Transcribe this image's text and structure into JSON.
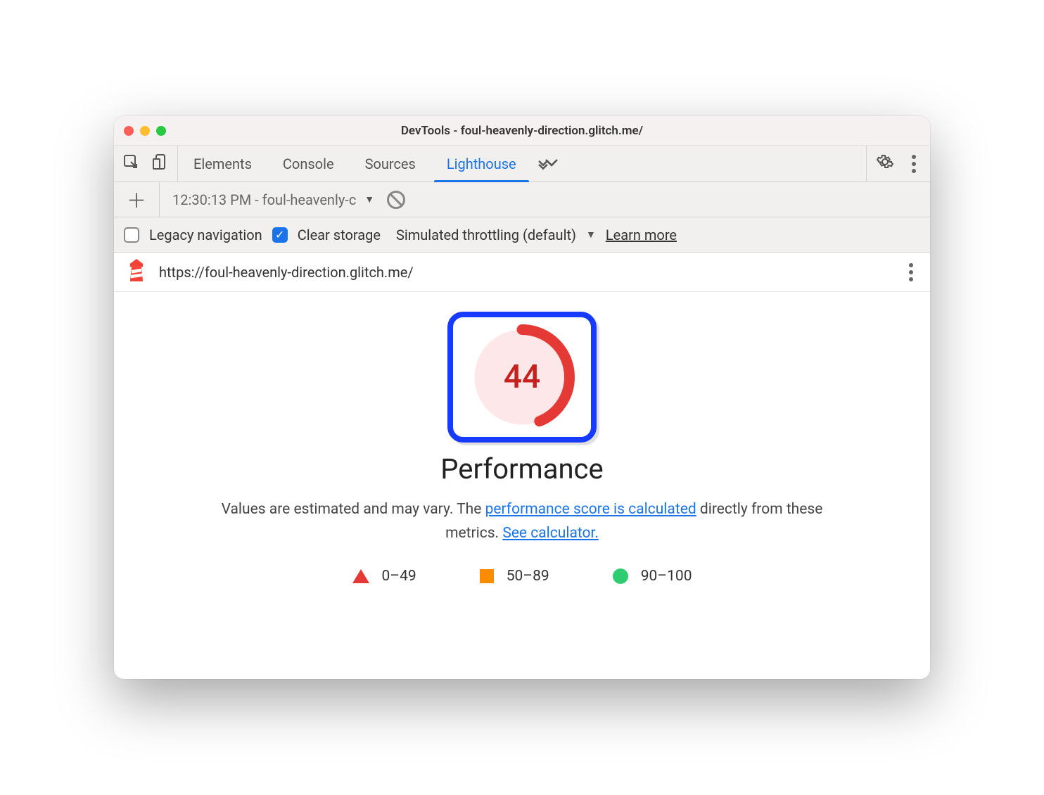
{
  "window": {
    "title": "DevTools - foul-heavenly-direction.glitch.me/"
  },
  "tabs": {
    "elements": "Elements",
    "console": "Console",
    "sources": "Sources",
    "lighthouse": "Lighthouse"
  },
  "secondary": {
    "report_label": "12:30:13 PM - foul-heavenly-c"
  },
  "options": {
    "legacy_label": "Legacy navigation",
    "clear_storage_label": "Clear storage",
    "throttling_label": "Simulated throttling (default)",
    "learn_more": "Learn more",
    "legacy_checked": false,
    "clear_storage_checked": true
  },
  "report": {
    "url": "https://foul-heavenly-direction.glitch.me/",
    "score": "44",
    "score_pct": 44,
    "category": "Performance",
    "desc_prefix": "Values are estimated and may vary. The ",
    "desc_link1": "performance score is calculated",
    "desc_mid": " directly from these metrics. ",
    "desc_link2": "See calculator."
  },
  "legend": {
    "low": "0–49",
    "mid": "50–89",
    "high": "90–100"
  },
  "colors": {
    "accent": "#1a73e8",
    "fail": "#e53935",
    "warn": "#fb8c00",
    "pass": "#2ecc71",
    "highlight_box": "#173aff"
  }
}
